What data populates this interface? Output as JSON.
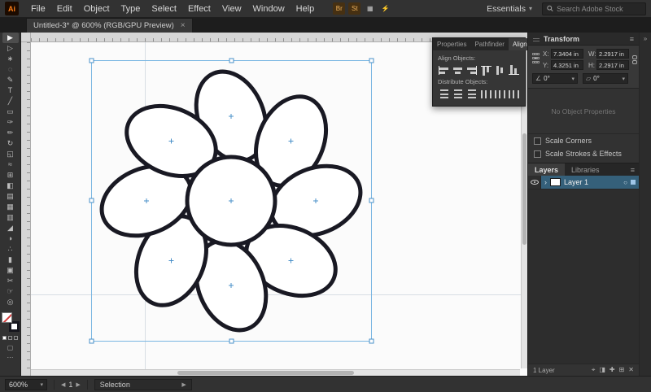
{
  "glyphs": {
    "chevron_down": "▾",
    "panel_menu": "≡",
    "collapse_chevron": "»",
    "expander": "›",
    "target_circle": "○",
    "rotate_icon": "∠",
    "shear_icon": "▱",
    "arrow_left": "◀",
    "arrow_right": "▶",
    "ellipsis": "⋯"
  },
  "menubar": {
    "logo": "Ai",
    "items": [
      "File",
      "Edit",
      "Object",
      "Type",
      "Select",
      "Effect",
      "View",
      "Window",
      "Help"
    ],
    "app_icons": [
      {
        "name": "bridge-icon",
        "glyph": "Br",
        "fg": "#f0b35c",
        "bg": "#463012"
      },
      {
        "name": "stock-icon",
        "glyph": "St",
        "fg": "#f0b35c",
        "bg": "#463012"
      },
      {
        "name": "arrange-documents-icon",
        "glyph": "▦",
        "fg": "#c9c9c9",
        "bg": "transparent"
      },
      {
        "name": "gpu-performance-icon",
        "glyph": "⚡",
        "fg": "#d957c4",
        "bg": "transparent"
      }
    ],
    "workspace_label": "Essentials",
    "search_placeholder": "Search Adobe Stock"
  },
  "document_tab": {
    "title": "Untitled-3* @ 600% (RGB/GPU Preview)",
    "close_glyph": "×"
  },
  "toolbar": {
    "tools": [
      {
        "name": "selection-tool",
        "glyph": "▶",
        "active": true
      },
      {
        "name": "direct-selection-tool",
        "glyph": "▷"
      },
      {
        "name": "magic-wand-tool",
        "glyph": "∗"
      },
      {
        "name": "lasso-tool",
        "glyph": "◌"
      },
      {
        "name": "pen-tool",
        "glyph": "✎"
      },
      {
        "name": "type-tool",
        "glyph": "T"
      },
      {
        "name": "line-segment-tool",
        "glyph": "╱"
      },
      {
        "name": "rectangle-tool",
        "glyph": "▭"
      },
      {
        "name": "paintbrush-tool",
        "glyph": "✑"
      },
      {
        "name": "pencil-tool",
        "glyph": "✏"
      },
      {
        "name": "rotate-tool",
        "glyph": "↻"
      },
      {
        "name": "scale-tool",
        "glyph": "◱"
      },
      {
        "name": "width-tool",
        "glyph": "≈"
      },
      {
        "name": "free-transform-tool",
        "glyph": "⊞"
      },
      {
        "name": "shape-builder-tool",
        "glyph": "◧"
      },
      {
        "name": "perspective-grid-tool",
        "glyph": "▤"
      },
      {
        "name": "mesh-tool",
        "glyph": "▦"
      },
      {
        "name": "gradient-tool",
        "glyph": "▥"
      },
      {
        "name": "eyedropper-tool",
        "glyph": "◢"
      },
      {
        "name": "blend-tool",
        "glyph": "◑"
      },
      {
        "name": "symbol-sprayer-tool",
        "glyph": "∴"
      },
      {
        "name": "column-graph-tool",
        "glyph": "▮"
      },
      {
        "name": "artboard-tool",
        "glyph": "▣"
      },
      {
        "name": "slice-tool",
        "glyph": "✂"
      },
      {
        "name": "hand-tool",
        "glyph": "☞"
      },
      {
        "name": "zoom-tool",
        "glyph": "◎"
      }
    ]
  },
  "align_panel": {
    "tabs": [
      {
        "label": "Properties"
      },
      {
        "label": "Pathfinder"
      },
      {
        "label": "Align",
        "active": true
      }
    ],
    "align_objects_label": "Align Objects:",
    "distribute_objects_label": "Distribute Objects:",
    "align_buttons": [
      {
        "name": "horizontal-align-left-button",
        "style": "h left",
        "bars": 2
      },
      {
        "name": "horizontal-align-center-button",
        "style": "h center",
        "bars": 2
      },
      {
        "name": "horizontal-align-right-button",
        "style": "h right",
        "bars": 2
      },
      {
        "name": "vertical-align-top-button",
        "style": "v top",
        "bars": 2
      },
      {
        "name": "vertical-align-center-button",
        "style": "v middle",
        "bars": 2
      },
      {
        "name": "vertical-align-bottom-button",
        "style": "v bottom",
        "bars": 2
      }
    ],
    "distribute_buttons": [
      {
        "name": "vertical-distribute-top-button",
        "style": "d-h",
        "bars": 3
      },
      {
        "name": "vertical-distribute-center-button",
        "style": "d-h",
        "bars": 3
      },
      {
        "name": "vertical-distribute-bottom-button",
        "style": "d-h",
        "bars": 3
      },
      {
        "name": "horizontal-distribute-left-button",
        "style": "d-v",
        "bars": 3
      },
      {
        "name": "horizontal-distribute-center-button",
        "style": "d-v",
        "bars": 3
      },
      {
        "name": "horizontal-distribute-right-button",
        "style": "d-v",
        "bars": 3
      }
    ]
  },
  "transform_panel": {
    "title": "Transform",
    "fields": {
      "x_label": "X:",
      "x_value": "7.3404 in",
      "y_label": "Y:",
      "y_value": "4.3251 in",
      "w_label": "W:",
      "w_value": "2.2917 in",
      "h_label": "H:",
      "h_value": "2.2917 in"
    },
    "rotate_value": "0°",
    "shear_value": "0°",
    "no_object_text": "No Object Properties",
    "scale_corners_label": "Scale Corners",
    "scale_strokes_label": "Scale Strokes & Effects"
  },
  "layers_panel": {
    "tabs": [
      {
        "label": "Layers",
        "active": true
      },
      {
        "label": "Libraries"
      }
    ],
    "layer_name": "Layer 1",
    "footer_count": "1 Layer",
    "footer_icons": [
      {
        "name": "locate-object-icon",
        "glyph": "⌖"
      },
      {
        "name": "make-mask-icon",
        "glyph": "◨"
      },
      {
        "name": "new-sublayer-icon",
        "glyph": "✚"
      },
      {
        "name": "new-layer-icon",
        "glyph": "⊞"
      },
      {
        "name": "delete-layer-icon",
        "glyph": "✕"
      }
    ]
  },
  "statusbar": {
    "zoom_value": "600%",
    "artboard_nav_value": "1",
    "tool_label": "Selection"
  },
  "colors": {
    "selection_blue": "#4a90c8",
    "artwork_stroke": "#191923",
    "layer_highlight": "#35607a"
  }
}
